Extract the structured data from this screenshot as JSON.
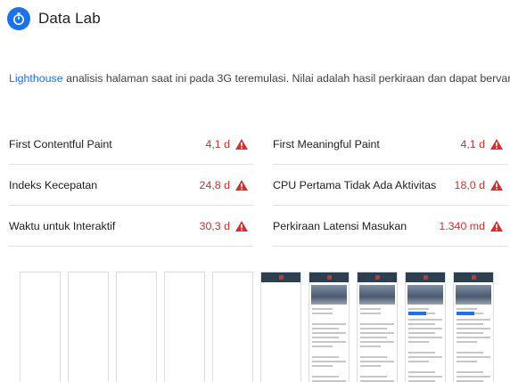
{
  "header": {
    "title": "Data Lab",
    "icon": "stopwatch-icon",
    "icon_color": "#1a73e8"
  },
  "description": {
    "link_text": "Lighthouse",
    "text": " analisis halaman saat ini pada 3G teremulasi. Nilai adalah hasil perkiraan dan dapat bervariasi."
  },
  "metrics": [
    {
      "label": "First Contentful Paint",
      "value": "4,1 d",
      "status": "warning"
    },
    {
      "label": "First Meaningful Paint",
      "value": "4,1 d",
      "status": "warning"
    },
    {
      "label": "Indeks Kecepatan",
      "value": "24,8 d",
      "status": "warning"
    },
    {
      "label": "CPU Pertama Tidak Ada Aktivitas",
      "value": "18,0 d",
      "status": "warning"
    },
    {
      "label": "Waktu untuk Interaktif",
      "value": "30,3 d",
      "status": "warning"
    },
    {
      "label": "Perkiraan Latensi Masukan",
      "value": "1.340 md",
      "status": "warning"
    }
  ],
  "colors": {
    "accent": "#1a73e8",
    "warning": "#d32f2f"
  },
  "filmstrip": [
    {
      "state": "blank"
    },
    {
      "state": "blank"
    },
    {
      "state": "blank"
    },
    {
      "state": "blank"
    },
    {
      "state": "blank"
    },
    {
      "state": "header"
    },
    {
      "state": "content"
    },
    {
      "state": "content"
    },
    {
      "state": "content-badge"
    },
    {
      "state": "content-badge"
    }
  ]
}
